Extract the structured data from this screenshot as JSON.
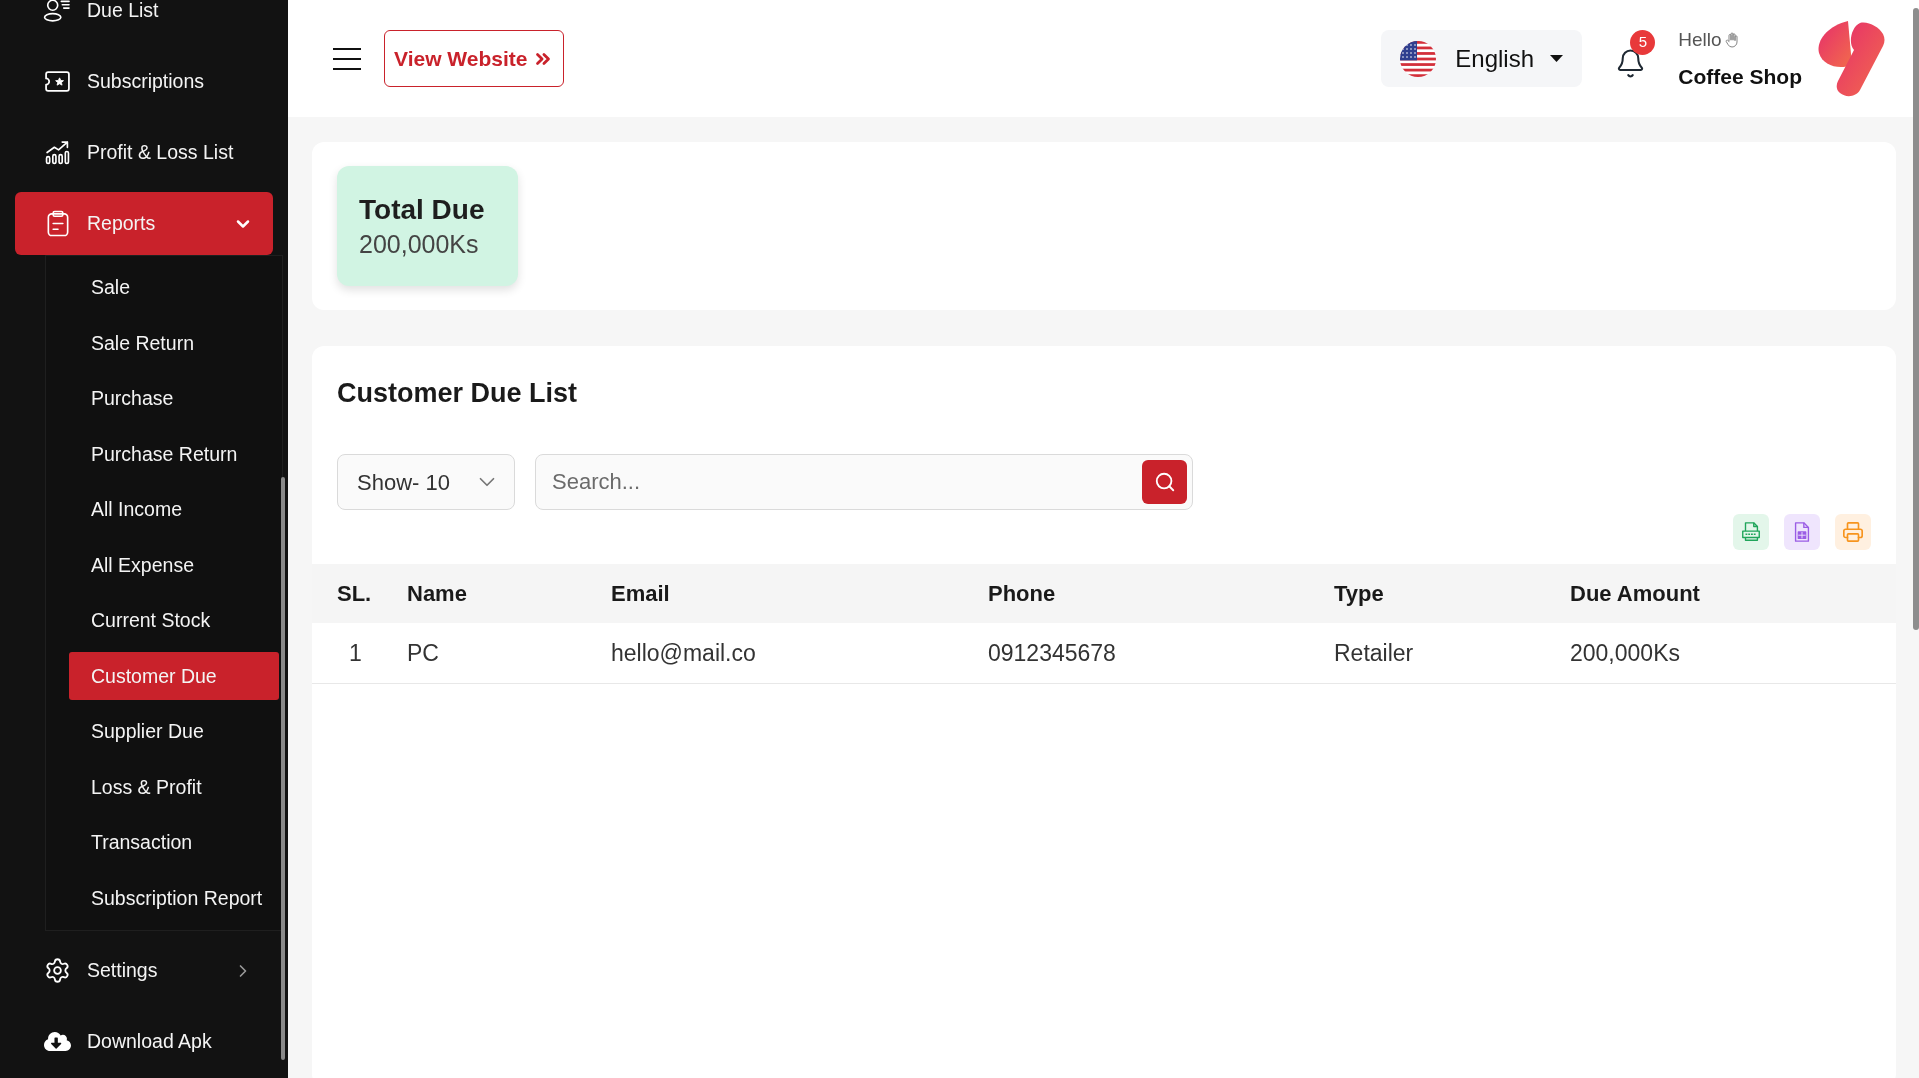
{
  "sidebar": {
    "items": [
      {
        "kind": "link",
        "label": "Due List",
        "selected": false
      },
      {
        "kind": "link",
        "label": "Subscriptions",
        "selected": false
      },
      {
        "kind": "link",
        "label": "Profit & Loss List",
        "selected": false
      },
      {
        "kind": "group",
        "label": "Reports",
        "selected": true,
        "expanded": true,
        "children": [
          {
            "label": "Sale",
            "selected": false
          },
          {
            "label": "Sale Return",
            "selected": false
          },
          {
            "label": "Purchase",
            "selected": false
          },
          {
            "label": "Purchase Return",
            "selected": false
          },
          {
            "label": "All Income",
            "selected": false
          },
          {
            "label": "All Expense",
            "selected": false
          },
          {
            "label": "Current Stock",
            "selected": false
          },
          {
            "label": "Customer Due",
            "selected": true
          },
          {
            "label": "Supplier Due",
            "selected": false
          },
          {
            "label": "Loss & Profit",
            "selected": false
          },
          {
            "label": "Transaction",
            "selected": false
          },
          {
            "label": "Subscription Report",
            "selected": false
          }
        ]
      },
      {
        "kind": "group",
        "label": "Settings",
        "selected": false,
        "expanded": false
      },
      {
        "kind": "link",
        "label": "Download Apk",
        "selected": false
      }
    ]
  },
  "header": {
    "view_website_button": {
      "label": "View Website"
    },
    "language": {
      "label": "English"
    },
    "notifications": {
      "count": "5"
    },
    "user": {
      "greeting": "Hello",
      "name": "Coffee Shop"
    }
  },
  "summary_cards": [
    {
      "title": "Total Due",
      "value": "200,000Ks"
    }
  ],
  "customer_due_list": {
    "title": "Customer Due List",
    "page_size": {
      "value": "Show- 10"
    },
    "search": {
      "placeholder": "Search..."
    },
    "table": {
      "columns": [
        "SL.",
        "Name",
        "Email",
        "Phone",
        "Type",
        "Due Amount"
      ],
      "rows": [
        [
          "1",
          "PC",
          "hello@mail.co",
          "0912345678",
          "Retailer",
          "200,000Ks"
        ]
      ]
    }
  }
}
